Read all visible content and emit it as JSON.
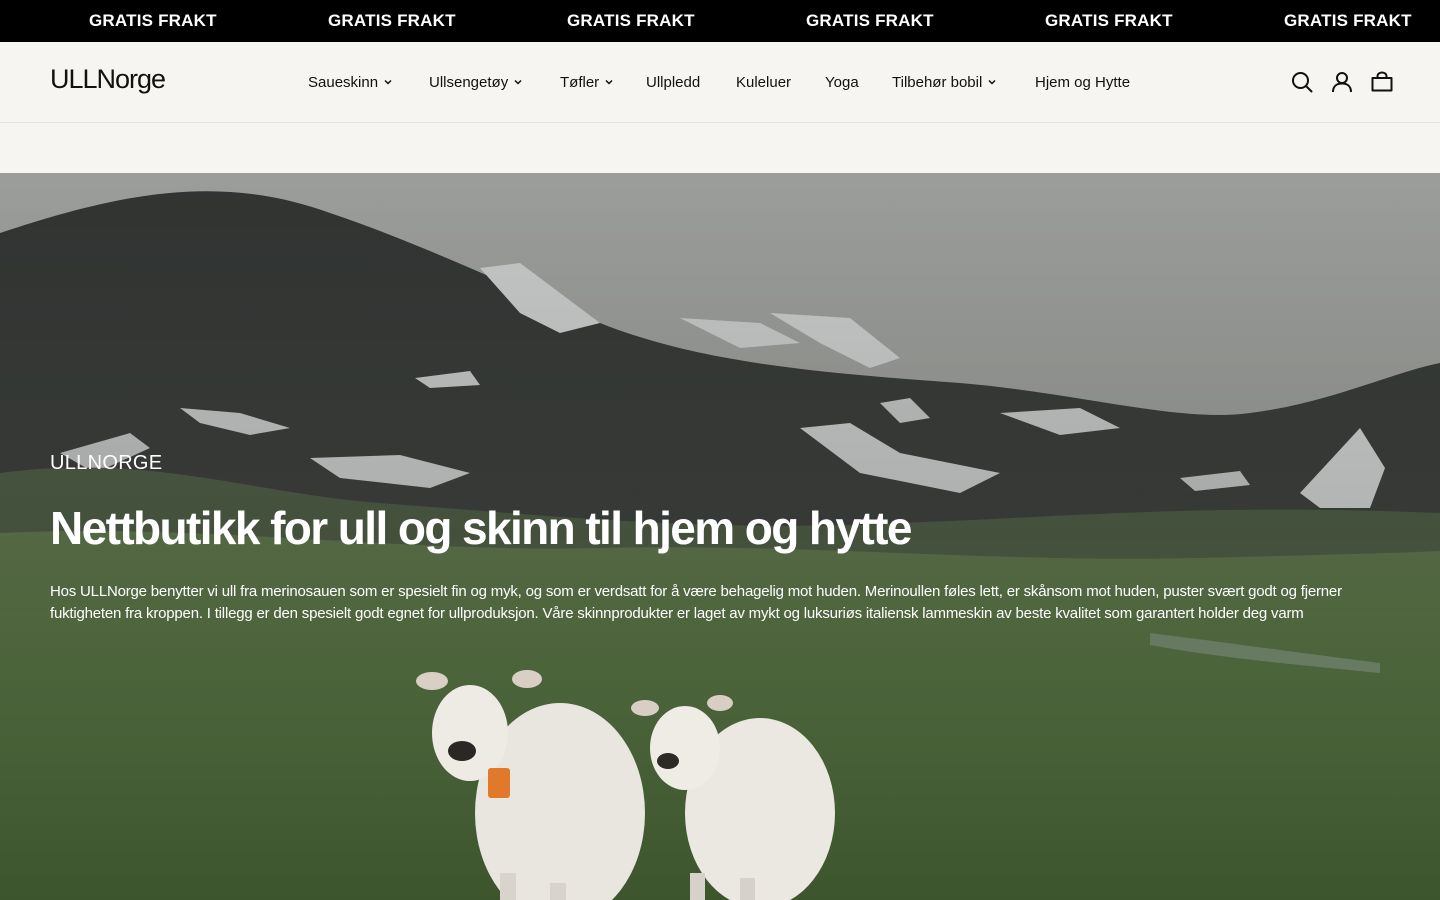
{
  "announcement": {
    "items": [
      "GRATIS FRAKT",
      "GRATIS FRAKT",
      "GRATIS FRAKT",
      "GRATIS FRAKT",
      "GRATIS FRAKT",
      "GRATIS FRAKT"
    ]
  },
  "header": {
    "logo": "ULLNorge",
    "nav": [
      {
        "label": "Saueskinn",
        "has_dropdown": true
      },
      {
        "label": "Ullsengetøy",
        "has_dropdown": true
      },
      {
        "label": "Tøfler",
        "has_dropdown": true
      },
      {
        "label": "Ullpledd",
        "has_dropdown": false
      },
      {
        "label": "Kuleluer",
        "has_dropdown": false
      },
      {
        "label": "Yoga",
        "has_dropdown": false
      },
      {
        "label": "Tilbehør bobil",
        "has_dropdown": true
      },
      {
        "label": "Hjem og Hytte",
        "has_dropdown": false
      }
    ],
    "icons": [
      "search-icon",
      "account-icon",
      "cart-icon"
    ]
  },
  "hero": {
    "eyebrow": "ULLNORGE",
    "title": "Nettbutikk for ull og skinn til hjem og hytte",
    "text": "Hos ULLNorge benytter vi ull fra merinosauen som er spesielt fin og myk, og som er verdsatt for å være behagelig mot huden. Merinoullen føles lett, er skånsom mot huden, puster svært godt og fjerner fuktigheten fra kroppen. I tillegg er den spesielt godt egnet for ullproduksjon. Våre skinnprodukter er laget av mykt og luksuriøs italiensk lammeskin av beste kvalitet som garantert holder deg varm"
  },
  "colors": {
    "announcement_bg": "#000000",
    "header_bg": "#f6f5f2",
    "text": "#111111",
    "hero_text": "#ffffff"
  }
}
